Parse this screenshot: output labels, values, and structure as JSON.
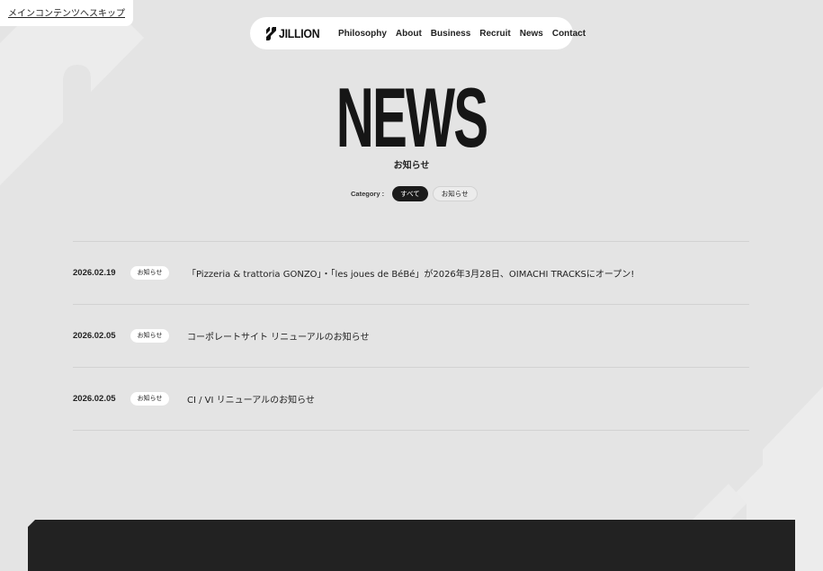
{
  "skip_link": "メインコンテンツへスキップ",
  "header": {
    "logo_text": "JILLION",
    "nav": [
      {
        "label": "Philosophy"
      },
      {
        "label": "About"
      },
      {
        "label": "Business"
      },
      {
        "label": "Recruit"
      },
      {
        "label": "News"
      },
      {
        "label": "Contact"
      }
    ]
  },
  "hero": {
    "title": "NEWS",
    "subtitle": "お知らせ"
  },
  "category": {
    "label": "Category :",
    "options": [
      {
        "label": "すべて",
        "active": true
      },
      {
        "label": "お知らせ",
        "active": false
      }
    ]
  },
  "news": [
    {
      "date": "2026.02.19",
      "tag": "お知らせ",
      "title": "「Pizzeria & trattoria GONZO」・「les joues de BéBé」が2026年3月28日、OIMACHI TRACKSにオープン!"
    },
    {
      "date": "2026.02.05",
      "tag": "お知らせ",
      "title": "コーポレートサイト リニューアルのお知らせ"
    },
    {
      "date": "2026.02.05",
      "tag": "お知らせ",
      "title": "CI / VI リニューアルのお知らせ"
    }
  ],
  "colors": {
    "background": "#e4e4e4",
    "accent_dark": "#1b1b1b",
    "footer": "#222222"
  }
}
